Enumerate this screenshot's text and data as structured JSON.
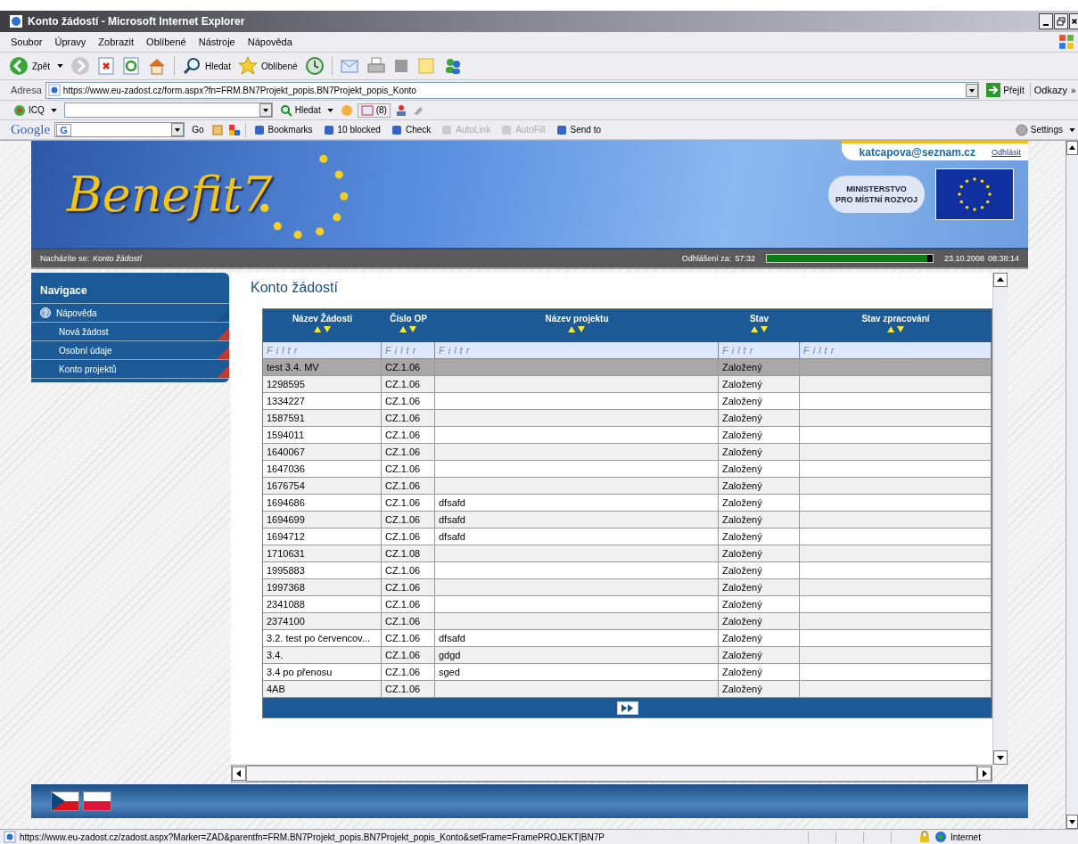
{
  "window": {
    "title": "Konto žádostí - Microsoft Internet Explorer"
  },
  "menu": [
    "Soubor",
    "Úpravy",
    "Zobrazit",
    "Oblíbené",
    "Nástroje",
    "Nápověda"
  ],
  "toolbar": {
    "back": "Zpět",
    "search": "Hledat",
    "favorites": "Oblíbené"
  },
  "address": {
    "label": "Adresa",
    "url": "https://www.eu-zadost.cz/form.aspx?fn=FRM.BN7Projekt_popis.BN7Projekt_popis_Konto",
    "go": "Přejít",
    "links": "Odkazy",
    "more": "»"
  },
  "icq_bar": {
    "label": "ICQ",
    "search": "Hledat",
    "count": "(8)"
  },
  "google_bar": {
    "logo": "Google",
    "engine": "G",
    "go": "Go",
    "items": [
      {
        "label": "Bookmarks",
        "disabled": false
      },
      {
        "label": "10 blocked",
        "disabled": false
      },
      {
        "label": "Check",
        "disabled": false
      },
      {
        "label": "AutoLink",
        "disabled": true
      },
      {
        "label": "AutoFill",
        "disabled": true
      },
      {
        "label": "Send to",
        "disabled": false
      }
    ],
    "settings": "Settings"
  },
  "header": {
    "user": "katcapova@seznam.cz",
    "logout": "Odhlásit",
    "logo": "Benefit7",
    "ministry": [
      "MINISTERSTVO",
      "PRO MÍSTNÍ ROZVOJ"
    ]
  },
  "infobar": {
    "location_label": "Nacházíte se:",
    "location": "Konto žádostí",
    "logout_label": "Odhlášení za:",
    "countdown": "57:32",
    "level": 0.97,
    "date": "23.10.2008",
    "time": "08:38:14"
  },
  "sidebar": {
    "title": "Navigace",
    "items": [
      {
        "label": "Nápověda",
        "kind": "help"
      },
      {
        "label": "Nová žádost",
        "kind": "link"
      },
      {
        "label": "Osobní údaje",
        "kind": "link"
      },
      {
        "label": "Konto projektů",
        "kind": "link"
      }
    ]
  },
  "main": {
    "title": "Konto žádostí"
  },
  "table": {
    "columns": [
      "Název Žádosti",
      "Číslo OP",
      "Název projektu",
      "Stav",
      "Stav zpracování"
    ],
    "filters": [
      {
        "placeholder": "Filtr"
      },
      {
        "placeholder": "Filtr"
      },
      {
        "placeholder": "Filtr"
      },
      {
        "placeholder": "Filtr"
      },
      {
        "placeholder": "Filtr"
      }
    ],
    "rows": [
      {
        "cells": [
          "test 3.4. MV",
          "CZ.1.06",
          "",
          "Založený",
          ""
        ],
        "selected": true
      },
      {
        "cells": [
          "1298595",
          "CZ.1.06",
          "",
          "Založený",
          ""
        ],
        "selected": false
      },
      {
        "cells": [
          "1334227",
          "CZ.1.06",
          "",
          "Založený",
          ""
        ],
        "selected": false
      },
      {
        "cells": [
          "1587591",
          "CZ.1.06",
          "",
          "Založený",
          ""
        ],
        "selected": false
      },
      {
        "cells": [
          "1594011",
          "CZ.1.06",
          "",
          "Založený",
          ""
        ],
        "selected": false
      },
      {
        "cells": [
          "1640067",
          "CZ.1.06",
          "",
          "Založený",
          ""
        ],
        "selected": false
      },
      {
        "cells": [
          "1647036",
          "CZ.1.06",
          "",
          "Založený",
          ""
        ],
        "selected": false
      },
      {
        "cells": [
          "1676754",
          "CZ.1.06",
          "",
          "Založený",
          ""
        ],
        "selected": false
      },
      {
        "cells": [
          "1694686",
          "CZ.1.06",
          "dfsafd",
          "Založený",
          ""
        ],
        "selected": false
      },
      {
        "cells": [
          "1694699",
          "CZ.1.06",
          "dfsafd",
          "Založený",
          ""
        ],
        "selected": false
      },
      {
        "cells": [
          "1694712",
          "CZ.1.06",
          "dfsafd",
          "Založený",
          ""
        ],
        "selected": false
      },
      {
        "cells": [
          "1710631",
          "CZ.1.08",
          "",
          "Založený",
          ""
        ],
        "selected": false
      },
      {
        "cells": [
          "1995883",
          "CZ.1.06",
          "",
          "Založený",
          ""
        ],
        "selected": false
      },
      {
        "cells": [
          "1997368",
          "CZ.1.06",
          "",
          "Založený",
          ""
        ],
        "selected": false
      },
      {
        "cells": [
          "2341088",
          "CZ.1.06",
          "",
          "Založený",
          ""
        ],
        "selected": false
      },
      {
        "cells": [
          "2374100",
          "CZ.1.06",
          "",
          "Založený",
          ""
        ],
        "selected": false
      },
      {
        "cells": [
          "3.2. test po červencov...",
          "CZ.1.06",
          "dfsafd",
          "Založený",
          ""
        ],
        "selected": false
      },
      {
        "cells": [
          "3.4.",
          "CZ.1.06",
          "gdgd",
          "Založený",
          ""
        ],
        "selected": false
      },
      {
        "cells": [
          "3.4 po přenosu",
          "CZ.1.06",
          "sged",
          "Založený",
          ""
        ],
        "selected": false
      },
      {
        "cells": [
          "4AB",
          "CZ.1.06",
          "",
          "Založený",
          ""
        ],
        "selected": false
      }
    ]
  },
  "status_bar": {
    "url": "https://www.eu-zadost.cz/zadost.aspx?Marker=ZAD&parentfn=FRM.BN7Projekt_popis.BN7Projekt_popis_Konto&setFrame=FramePROJEKT|BN7P",
    "zone": "Internet"
  }
}
